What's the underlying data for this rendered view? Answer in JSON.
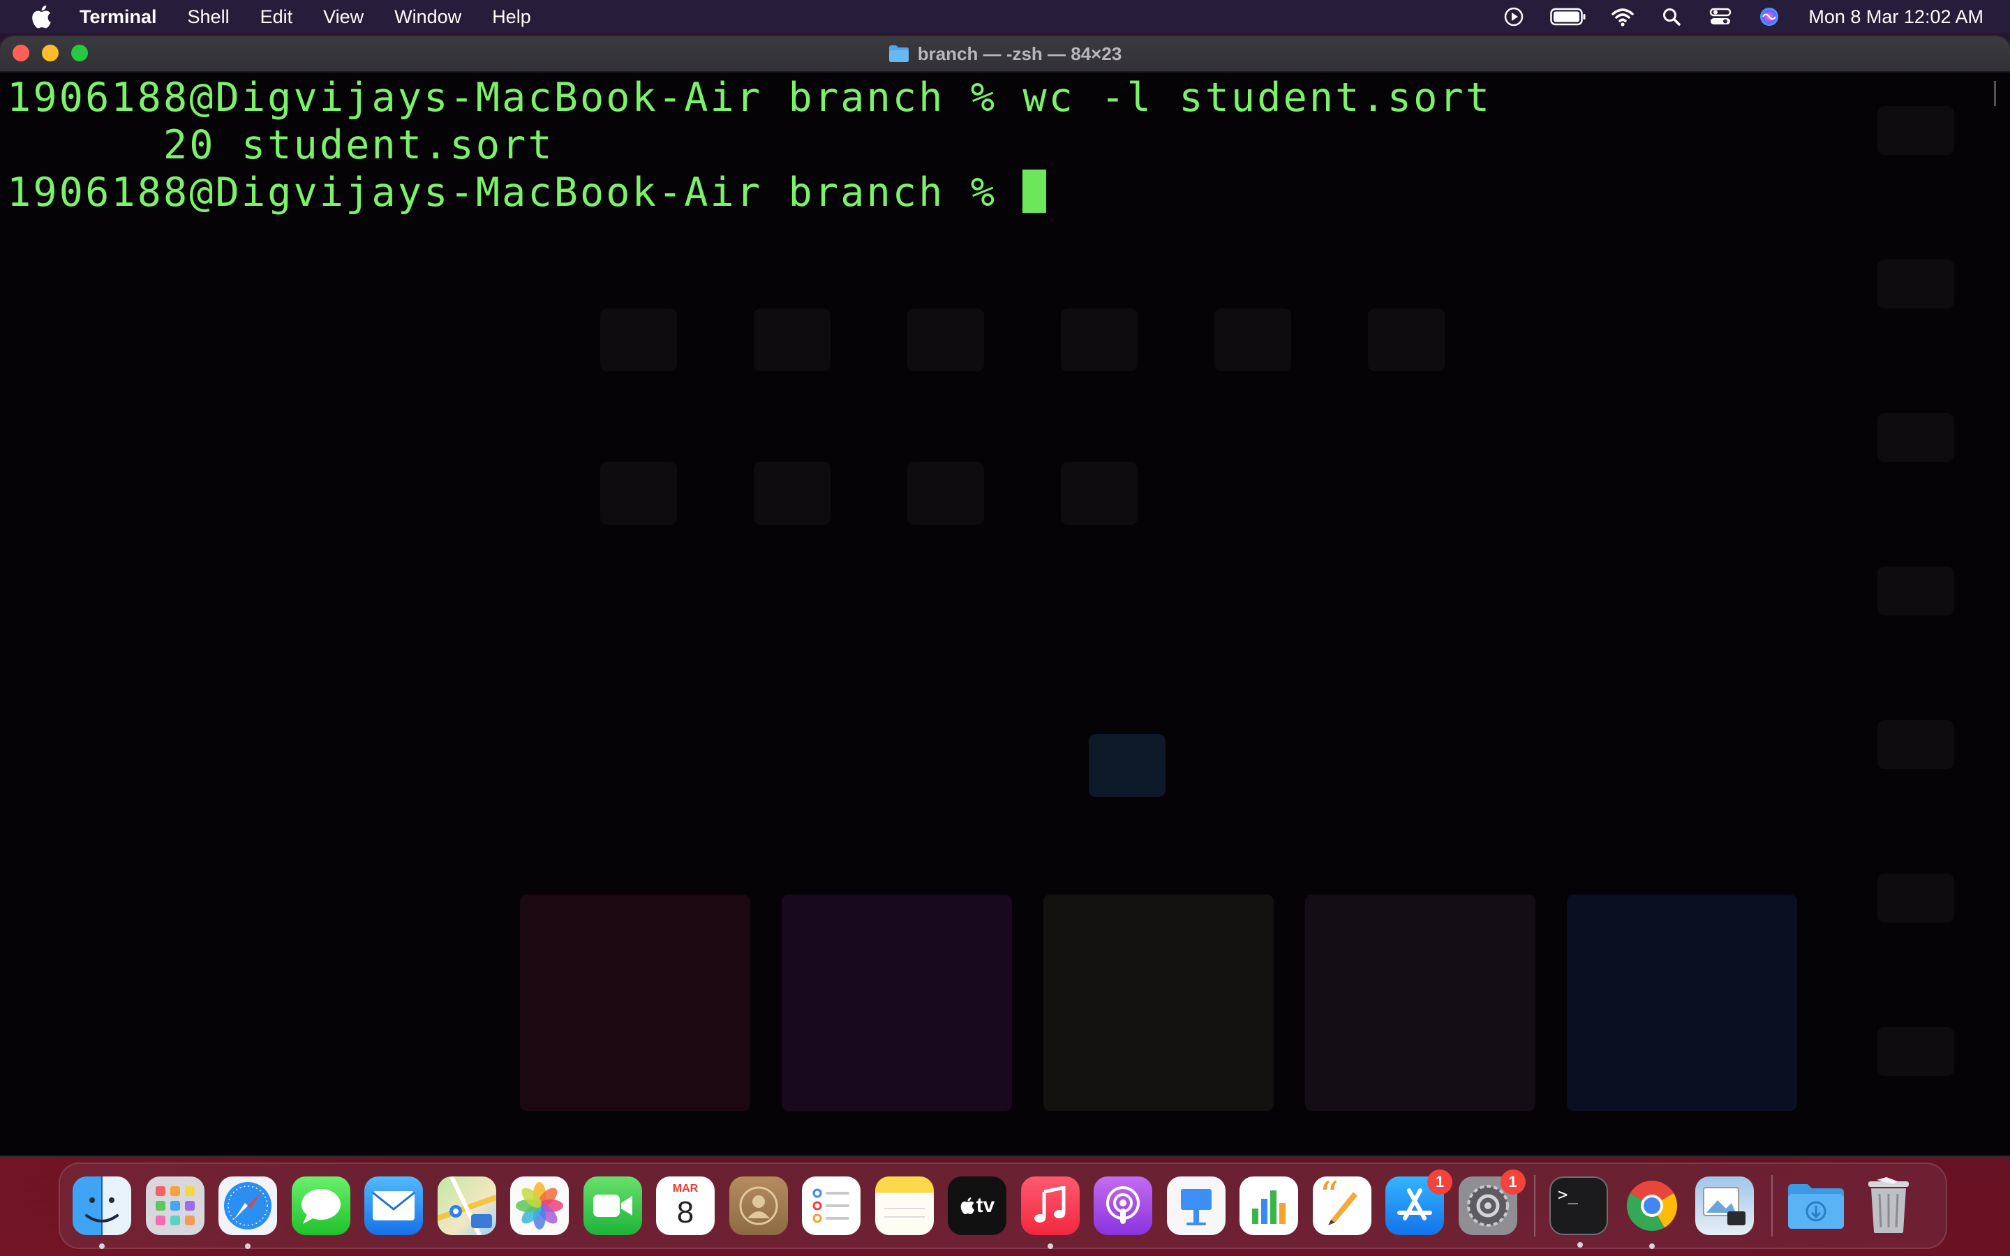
{
  "menubar": {
    "app_name": "Terminal",
    "menus": [
      "Shell",
      "Edit",
      "View",
      "Window",
      "Help"
    ],
    "clock": "Mon 8 Mar  12:02 AM"
  },
  "window": {
    "title": "branch — -zsh — 84×23"
  },
  "terminal": {
    "lines": [
      "1906188@Digvijays-MacBook-Air branch % wc -l student.sort",
      "      20 student.sort",
      "1906188@Digvijays-MacBook-Air branch % "
    ]
  },
  "dock": {
    "calendar_month": "MAR",
    "calendar_day": "8",
    "tv_label": "tv",
    "appstore_badge": "1",
    "settings_badge": "1",
    "terminal_prompt": ">_",
    "pages_quote": "“"
  },
  "colors": {
    "terminal_text": "#7cf26a",
    "terminal_background": "#050306",
    "badge": "#f4433c"
  }
}
